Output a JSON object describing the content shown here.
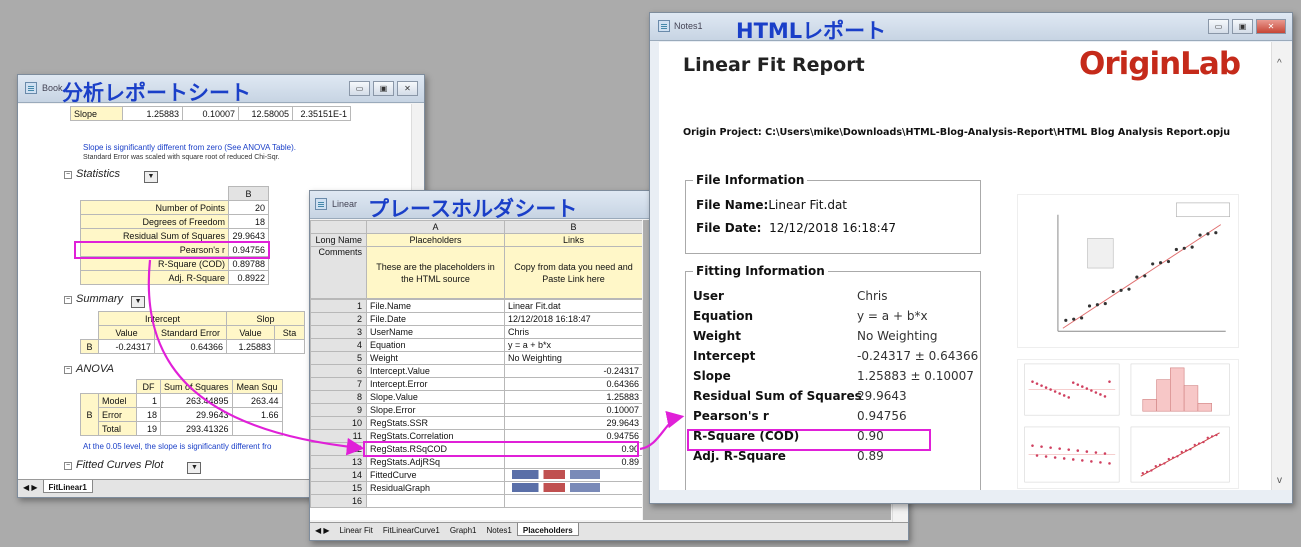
{
  "book": {
    "title_small": "Book",
    "title": "分析レポートシート",
    "slope_row": {
      "label": "Slope",
      "v1": "1.25883",
      "v2": "0.10007",
      "v3": "12.58005",
      "v4": "2.35151E-1"
    },
    "note1": "Slope is significantly different from zero (See ANOVA Table).",
    "note2": "Standard Error was scaled with square root of reduced Chi-Sqr.",
    "stats_label": "Statistics",
    "stats_col": "B",
    "stats_rows": [
      {
        "label": "Number of Points",
        "value": "20"
      },
      {
        "label": "Degrees of Freedom",
        "value": "18"
      },
      {
        "label": "Residual Sum of Squares",
        "value": "29.9643"
      },
      {
        "label": "Pearson's r",
        "value": "0.94756"
      },
      {
        "label": "R-Square (COD)",
        "value": "0.89788"
      },
      {
        "label": "Adj. R-Square",
        "value": "0.8922"
      }
    ],
    "summary_label": "Summary",
    "summary_intercept": "Intercept",
    "summary_slope": "Slop",
    "summary_cols": [
      "Value",
      "Standard Error",
      "Value",
      "Sta"
    ],
    "summary_row": [
      "B",
      "-0.24317",
      "0.64366",
      "1.25883"
    ],
    "anova_label": "ANOVA",
    "anova_cols": [
      "DF",
      "Sum of Squares",
      "Mean Squ"
    ],
    "anova_b": "B",
    "anova_rows": [
      {
        "name": "Model",
        "df": "1",
        "ss": "263.44895",
        "ms": "263.44"
      },
      {
        "name": "Error",
        "df": "18",
        "ss": "29.9643",
        "ms": "1.66"
      },
      {
        "name": "Total",
        "df": "19",
        "ss": "293.41326",
        "ms": ""
      }
    ],
    "anova_note": "At the 0.05 level, the slope is significantly different fro",
    "fitted_label": "Fitted Curves Plot",
    "tab": "FitLinear1"
  },
  "placeholders": {
    "title_small": "Linear",
    "title": "プレースホルダシート",
    "colA": "A",
    "colB": "B",
    "long_name": "Long Name",
    "comments": "Comments",
    "a_longname": "Placeholders",
    "b_longname": "Links",
    "a_comment": "These are the placeholders in the HTML source",
    "b_comment": "Copy from data you need and Paste Link here",
    "rows": [
      {
        "n": "1",
        "a": "File.Name",
        "b": "Linear Fit.dat",
        "num": false
      },
      {
        "n": "2",
        "a": "File.Date",
        "b": "12/12/2018 16:18:47",
        "num": false
      },
      {
        "n": "3",
        "a": "UserName",
        "b": "Chris",
        "num": false
      },
      {
        "n": "4",
        "a": "Equation",
        "b": "y = a + b*x",
        "num": false
      },
      {
        "n": "5",
        "a": "Weight",
        "b": "No Weighting",
        "num": false
      },
      {
        "n": "6",
        "a": "Intercept.Value",
        "b": "-0.24317",
        "num": true
      },
      {
        "n": "7",
        "a": "Intercept.Error",
        "b": "0.64366",
        "num": true
      },
      {
        "n": "8",
        "a": "Slope.Value",
        "b": "1.25883",
        "num": true
      },
      {
        "n": "9",
        "a": "Slope.Error",
        "b": "0.10007",
        "num": true
      },
      {
        "n": "10",
        "a": "RegStats.SSR",
        "b": "29.9643",
        "num": true
      },
      {
        "n": "11",
        "a": "RegStats.Correlation",
        "b": "0.94756",
        "num": true
      },
      {
        "n": "12",
        "a": "RegStats.RSqCOD",
        "b": "0.90",
        "num": true
      },
      {
        "n": "13",
        "a": "RegStats.AdjRSq",
        "b": "0.89",
        "num": true
      },
      {
        "n": "14",
        "a": "FittedCurve",
        "b": "",
        "num": false
      },
      {
        "n": "15",
        "a": "ResidualGraph",
        "b": "",
        "num": false
      },
      {
        "n": "16",
        "a": "",
        "b": "",
        "num": false
      }
    ],
    "tabs": [
      "Linear Fit",
      "FitLinearCurve1",
      "Graph1",
      "Notes1",
      "Placeholders"
    ]
  },
  "notes": {
    "title_small": "Notes1",
    "title": "HTMLレポート",
    "report_title": "Linear Fit Report",
    "logo": "OriginLab",
    "project_label": "Origin Project:",
    "project_path": "C:\\Users\\mike\\Downloads\\HTML-Blog-Analysis-Report\\HTML Blog Analysis Report.opju",
    "file_info_legend": "File Information",
    "file_name_label": "File Name:",
    "file_name": "Linear Fit.dat",
    "file_date_label": "File Date:",
    "file_date": "12/12/2018 16:18:47",
    "fitting_legend": "Fitting Information",
    "fitting": [
      {
        "key": "User",
        "value": "Chris"
      },
      {
        "key": "Equation",
        "value": "y = a + b*x"
      },
      {
        "key": "Weight",
        "value": "No Weighting"
      },
      {
        "key": "Intercept",
        "value": "-0.24317 ± 0.64366"
      },
      {
        "key": "Slope",
        "value": "1.25883 ± 0.10007"
      },
      {
        "key": "Residual Sum of Squares",
        "value": "29.9643"
      },
      {
        "key": "Pearson's r",
        "value": "0.94756"
      },
      {
        "key": "R-Square (COD)",
        "value": "0.90"
      },
      {
        "key": "Adj. R-Square",
        "value": "0.89"
      }
    ]
  },
  "colors": {
    "highlight": "#e020d8",
    "title_blue": "#1a3fc8",
    "logo_red": "#c52a1a"
  }
}
